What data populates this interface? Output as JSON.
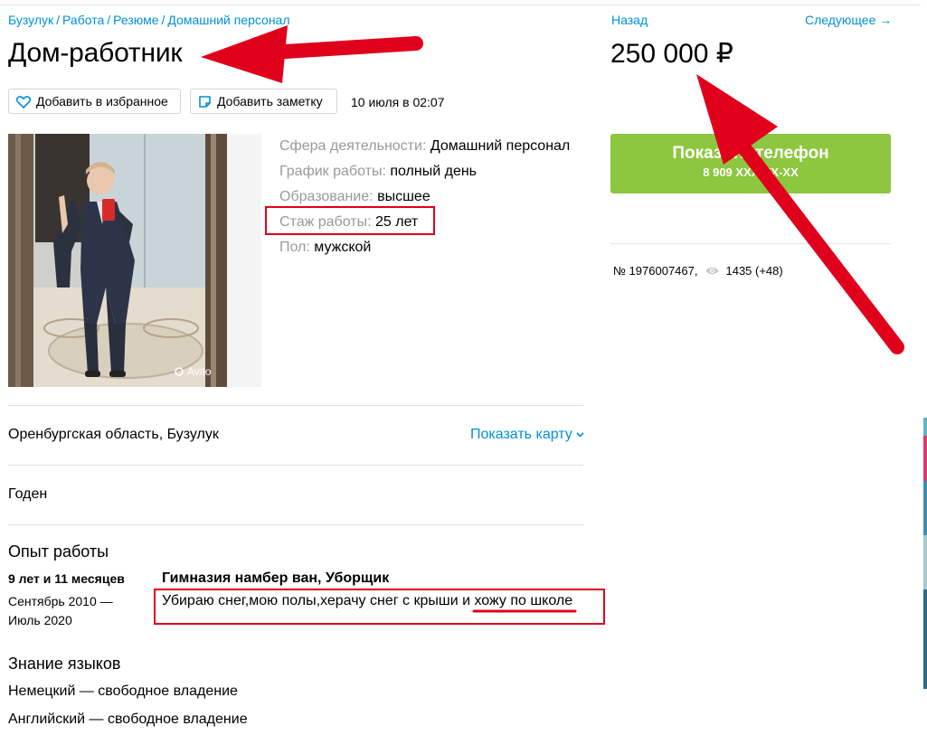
{
  "breadcrumb": [
    "Бузулук",
    "Работа",
    "Резюме",
    "Домашний персонал"
  ],
  "breadcrumb_sep": "/",
  "title": "Дом-работник",
  "actions": {
    "favorite_label": "Добавить в избранное",
    "note_label": "Добавить заметку",
    "date": "10 июля в 02:07"
  },
  "params": [
    {
      "label": "Сфера деятельности:",
      "value": "Домашний персонал"
    },
    {
      "label": "График работы:",
      "value": "полный день"
    },
    {
      "label": "Образование:",
      "value": "высшее"
    },
    {
      "label": "Стаж работы:",
      "value": "25 лет"
    },
    {
      "label": "Пол:",
      "value": "мужской"
    }
  ],
  "photo_watermark": "Avito",
  "location": {
    "address": "Оренбургская область, Бузулук",
    "show_map": "Показать карту"
  },
  "description": "Годен",
  "experience": {
    "heading": "Опыт работы",
    "duration": "9 лет и 11 месяцев",
    "dates_line1": "Сентябрь 2010 —",
    "dates_line2": "Июль 2020",
    "position": "Гимназия намбер ван, Уборщик",
    "desc_part1": "Убираю снег,мою полы,херачу снег с крыши и ",
    "desc_part2": "хожу по школе"
  },
  "languages": {
    "heading": "Знание языков",
    "items": [
      "Немецкий — свободное владение",
      "Английский — свободное владение"
    ]
  },
  "sidebar": {
    "back": "Назад",
    "next": "Следующее →",
    "price": "250 000 ₽",
    "show_phone": "Показать телефон",
    "phone_masked": "8 909 XXX-XX-XX",
    "ad_number": "№ 1976007467,",
    "views": "1435 (+48)"
  },
  "colors": {
    "link": "#0091d9",
    "accent_green": "#8dc63f",
    "annotation_red": "#e0001b"
  }
}
